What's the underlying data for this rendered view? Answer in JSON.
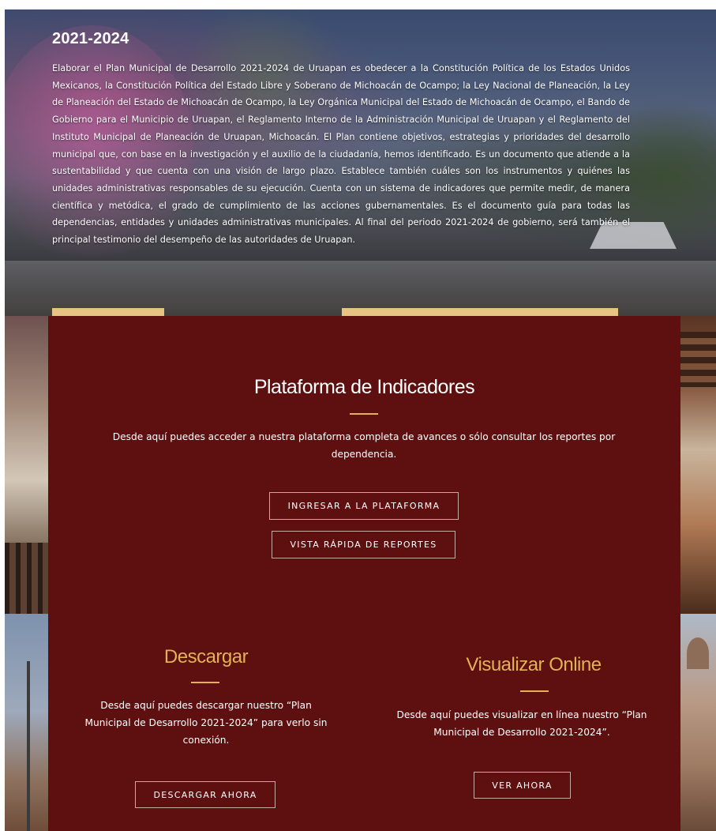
{
  "hero": {
    "title": "2021-2024",
    "text": "Elaborar el Plan Municipal de Desarrollo 2021-2024 de Uruapan es obedecer a  la Constitución Política de los Estados Unidos Mexicanos, la Constitución Política del Estado Libre y Soberano de Michoacán de Ocampo;  la Ley Nacional de Planeación,  la Ley de Planeación del Estado de Michoacán de Ocampo, la Ley Orgánica Municipal del Estado de Michoacán de Ocampo, el Bando de Gobierno para el Municipio de Uruapan, el Reglamento Interno de la Administración Municipal de Uruapan y el Reglamento del Instituto Municipal de Planeación de Uruapan, Michoacán. El Plan contiene objetivos, estrategias y prioridades del desarrollo municipal que, con base en la investigación y el auxilio de la ciudadanía, hemos identificado. Es un documento que atiende a la sustentabilidad y que cuenta con una visión de largo plazo. Establece también cuáles son los instrumentos y quiénes las unidades administrativas responsables de su ejecución. Cuenta con un sistema de indicadores que permite medir, de manera científica y metódica, el grado de cumplimiento de las acciones gubernamentales. Es el documento guía para todas las dependencias, entidades y unidades administrativas municipales. Al final del periodo 2021-2024 de gobierno, será también el principal testimonio del desempeño de las autoridades de Uruapan."
  },
  "indicadores": {
    "title": "Plataforma de Indicadores",
    "description": "Desde aquí puedes acceder a nuestra plataforma completa de avances o sólo consultar los reportes por dependencia.",
    "btn_plataforma": "INGRESAR A LA PLATAFORMA",
    "btn_reportes": "VISTA RÁPIDA DE REPORTES"
  },
  "descargar": {
    "title": "Descargar",
    "description": "Desde aquí puedes descargar nuestro “Plan Municipal de Desarrollo 2021-2024” para verlo sin conexión.",
    "button": "DESCARGAR AHORA"
  },
  "visualizar": {
    "title": "Visualizar Online",
    "description": "Desde aquí puedes visualizar en línea nuestro “Plan Municipal de Desarrollo 2021-2024”.",
    "button": "VER AHORA"
  },
  "colors": {
    "panel": "#5e0f0f",
    "accent": "#e2b254",
    "tab_strip": "#e7c483"
  }
}
